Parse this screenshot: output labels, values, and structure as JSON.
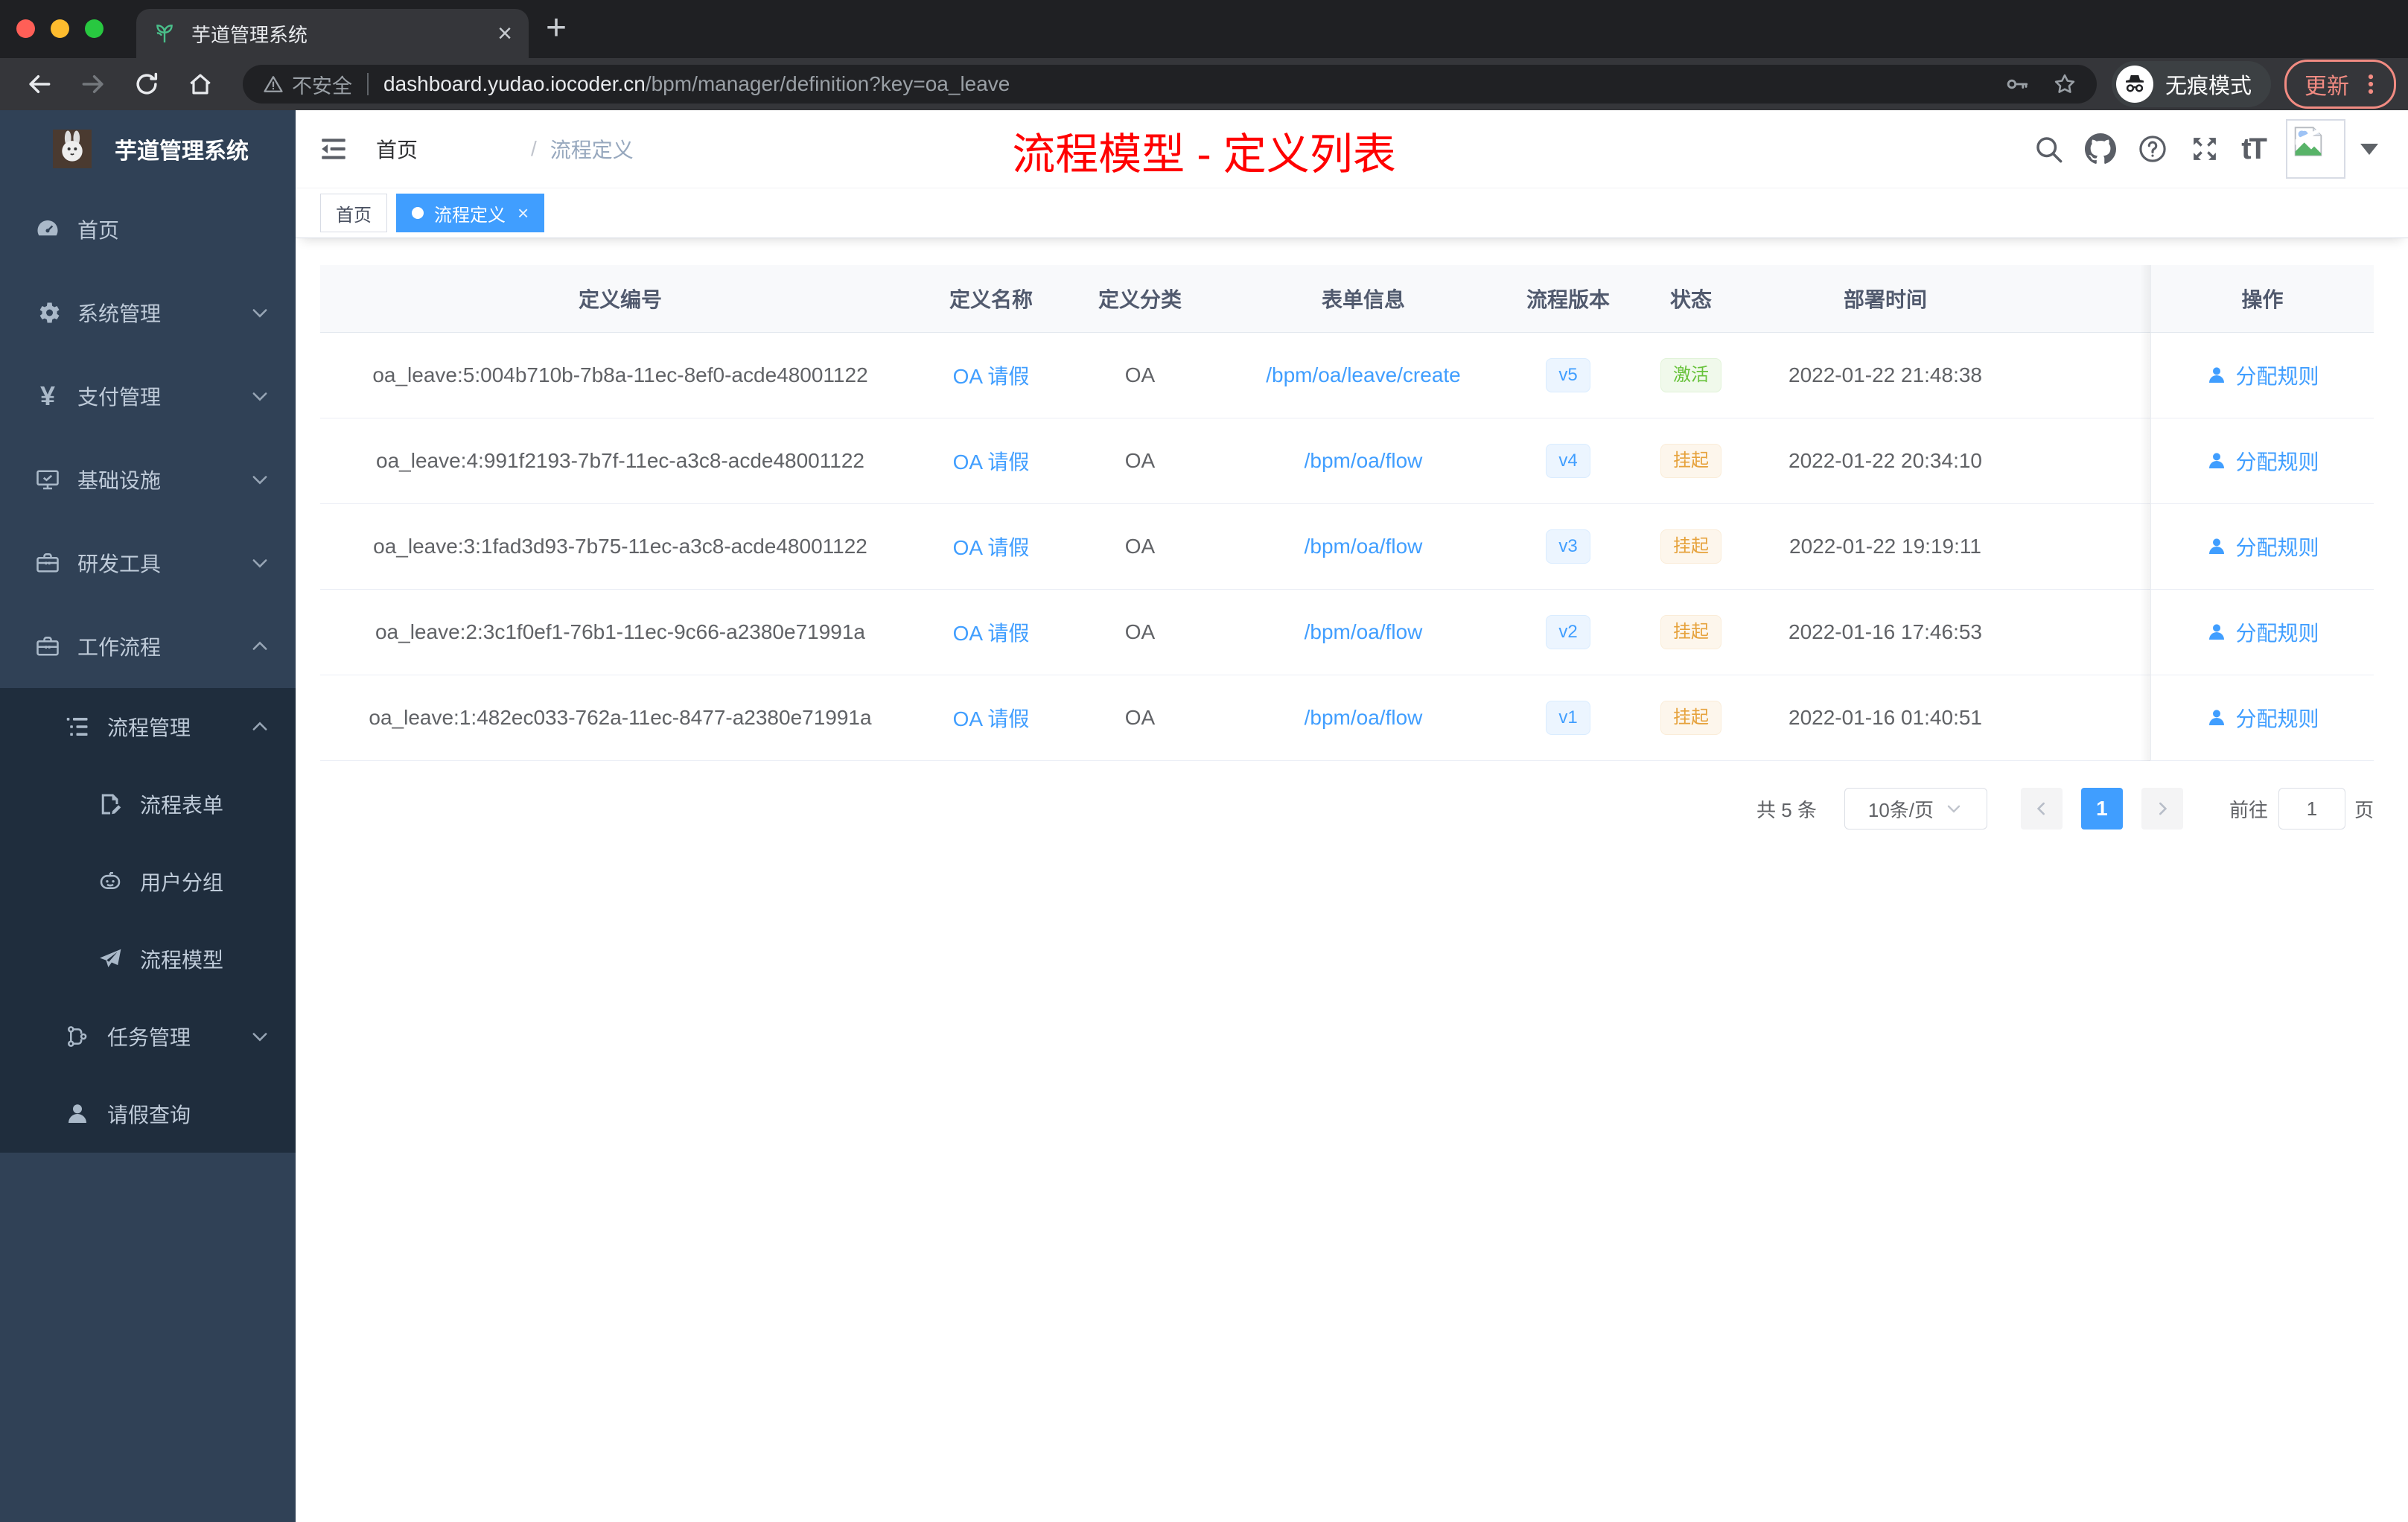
{
  "browser": {
    "tab_title": "芋道管理系统",
    "security_label": "不安全",
    "url_host": "dashboard.yudao.iocoder.cn",
    "url_path": "/bpm/manager/definition?key=oa_leave",
    "incognito_label": "无痕模式",
    "update_button": "更新"
  },
  "glyphs": {
    "close": "×",
    "plus": "+",
    "yen": "¥",
    "font_size": "tT",
    "breadcrumb_sep": "/"
  },
  "colors": {
    "accent": "#409eff",
    "sidebar_bg": "#304156",
    "submenu_bg": "#1f2d3d",
    "annotation_red": "#ff0000",
    "success": "#67c23a",
    "warning": "#e6a23c"
  },
  "sidebar": {
    "app_title": "芋道管理系统",
    "items": [
      {
        "label": "首页",
        "icon": "dashboard-icon",
        "level": 0,
        "chevron": "none",
        "in_submenu": false
      },
      {
        "label": "系统管理",
        "icon": "gear-icon",
        "level": 0,
        "chevron": "down",
        "in_submenu": false
      },
      {
        "label": "支付管理",
        "icon": "yen-icon",
        "level": 0,
        "chevron": "down",
        "in_submenu": false
      },
      {
        "label": "基础设施",
        "icon": "monitor-icon",
        "level": 0,
        "chevron": "down",
        "in_submenu": false
      },
      {
        "label": "研发工具",
        "icon": "toolbox-icon",
        "level": 0,
        "chevron": "down",
        "in_submenu": false
      },
      {
        "label": "工作流程",
        "icon": "briefcase-icon",
        "level": 0,
        "chevron": "up",
        "in_submenu": false
      },
      {
        "label": "流程管理",
        "icon": "list-tree-icon",
        "level": 1,
        "chevron": "up",
        "in_submenu": true
      },
      {
        "label": "流程表单",
        "icon": "form-edit-icon",
        "level": 2,
        "chevron": "none",
        "in_submenu": true
      },
      {
        "label": "用户分组",
        "icon": "robot-icon",
        "level": 2,
        "chevron": "none",
        "in_submenu": true
      },
      {
        "label": "流程模型",
        "icon": "paper-plane-icon",
        "level": 2,
        "chevron": "none",
        "in_submenu": true
      },
      {
        "label": "任务管理",
        "icon": "org-tree-icon",
        "level": 1,
        "chevron": "down",
        "in_submenu": true
      },
      {
        "label": "请假查询",
        "icon": "user-icon",
        "level": 1,
        "chevron": "none",
        "in_submenu": true
      }
    ]
  },
  "header": {
    "breadcrumb": [
      "首页",
      "流程定义"
    ],
    "overlay_title": "流程模型 - 定义列表",
    "icons": [
      "search-icon",
      "github-icon",
      "question-icon",
      "fullscreen-icon",
      "font-size-icon",
      "avatar",
      "dropdown-caret-icon"
    ]
  },
  "tags_view": {
    "tabs": [
      {
        "label": "首页",
        "active": false,
        "closable": false
      },
      {
        "label": "流程定义",
        "active": true,
        "closable": true
      }
    ]
  },
  "table": {
    "columns": [
      "定义编号",
      "定义名称",
      "定义分类",
      "表单信息",
      "流程版本",
      "状态",
      "部署时间",
      "操作"
    ],
    "action_label": "分配规则",
    "rows": [
      {
        "id": "oa_leave:5:004b710b-7b8a-11ec-8ef0-acde48001122",
        "name": "OA 请假",
        "category": "OA",
        "form": "/bpm/oa/leave/create",
        "version": "v5",
        "status": "激活",
        "status_type": "success",
        "deployed_at": "2022-01-22 21:48:38"
      },
      {
        "id": "oa_leave:4:991f2193-7b7f-11ec-a3c8-acde48001122",
        "name": "OA 请假",
        "category": "OA",
        "form": "/bpm/oa/flow",
        "version": "v4",
        "status": "挂起",
        "status_type": "warning",
        "deployed_at": "2022-01-22 20:34:10"
      },
      {
        "id": "oa_leave:3:1fad3d93-7b75-11ec-a3c8-acde48001122",
        "name": "OA 请假",
        "category": "OA",
        "form": "/bpm/oa/flow",
        "version": "v3",
        "status": "挂起",
        "status_type": "warning",
        "deployed_at": "2022-01-22 19:19:11"
      },
      {
        "id": "oa_leave:2:3c1f0ef1-76b1-11ec-9c66-a2380e71991a",
        "name": "OA 请假",
        "category": "OA",
        "form": "/bpm/oa/flow",
        "version": "v2",
        "status": "挂起",
        "status_type": "warning",
        "deployed_at": "2022-01-16 17:46:53"
      },
      {
        "id": "oa_leave:1:482ec033-762a-11ec-8477-a2380e71991a",
        "name": "OA 请假",
        "category": "OA",
        "form": "/bpm/oa/flow",
        "version": "v1",
        "status": "挂起",
        "status_type": "warning",
        "deployed_at": "2022-01-16 01:40:51"
      }
    ]
  },
  "pagination": {
    "total_label": "共 5 条",
    "page_size_label": "10条/页",
    "current_page": "1",
    "goto_label": "前往",
    "goto_value": "1",
    "page_unit": "页"
  }
}
